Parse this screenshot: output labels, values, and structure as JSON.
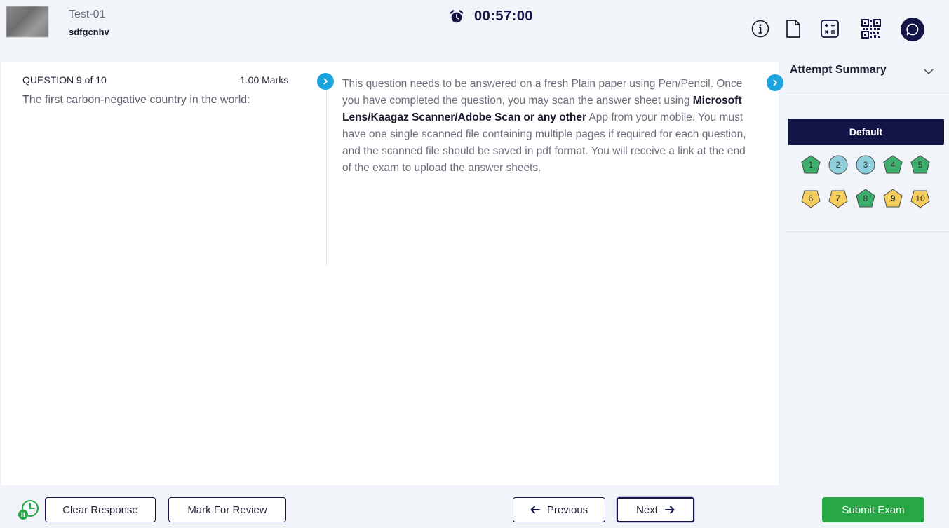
{
  "header": {
    "test_name": "Test-01",
    "user_name": "sdfgcnhv",
    "timer": "00:57:00",
    "tools": [
      "info-icon",
      "document-icon",
      "calculator-icon",
      "qr-code-icon",
      "chat-icon"
    ]
  },
  "question": {
    "label": "QUESTION 9 of 10",
    "marks": "1.00 Marks",
    "text": "The first carbon-negative country in the world:",
    "instructions": {
      "part1": "This question needs to be answered on a fresh Plain paper using Pen/Pencil. Once you have completed the question, you may scan the answer sheet using ",
      "bold": "Microsoft Lens/Kaagaz Scanner/Adobe Scan or any other",
      "part2": " App from your mobile. You must have one single scanned file containing multiple pages if required for each question, and the scanned file should be saved in pdf format. You will receive a link at the end of the exam to upload the answer sheets."
    }
  },
  "sidebar": {
    "title": "Attempt Summary",
    "section_button": "Default",
    "questions": [
      {
        "num": "1",
        "status": "answered",
        "shape": "pentagon",
        "color": "#3dae6b"
      },
      {
        "num": "2",
        "status": "visited",
        "shape": "circle",
        "color": "#8fcfdc"
      },
      {
        "num": "3",
        "status": "visited",
        "shape": "circle",
        "color": "#8fcfdc"
      },
      {
        "num": "4",
        "status": "answered",
        "shape": "pentagon",
        "color": "#3dae6b"
      },
      {
        "num": "5",
        "status": "answered",
        "shape": "pentagon",
        "color": "#3dae6b"
      },
      {
        "num": "6",
        "status": "not-answered",
        "shape": "inv-pentagon",
        "color": "#f5cd5b"
      },
      {
        "num": "7",
        "status": "not-answered",
        "shape": "inv-pentagon",
        "color": "#f5cd5b"
      },
      {
        "num": "8",
        "status": "answered",
        "shape": "pentagon",
        "color": "#3dae6b"
      },
      {
        "num": "9",
        "status": "current",
        "shape": "pentagon",
        "color": "#f5cd5b"
      },
      {
        "num": "10",
        "status": "not-answered",
        "shape": "inv-pentagon",
        "color": "#f5cd5b"
      }
    ]
  },
  "footer": {
    "clear_label": "Clear Response",
    "review_label": "Mark For Review",
    "previous_label": "Previous",
    "next_label": "Next",
    "submit_label": "Submit Exam"
  },
  "colors": {
    "navy": "#121545",
    "accent_blue": "#1ba3dd",
    "submit_green": "#27a844"
  }
}
